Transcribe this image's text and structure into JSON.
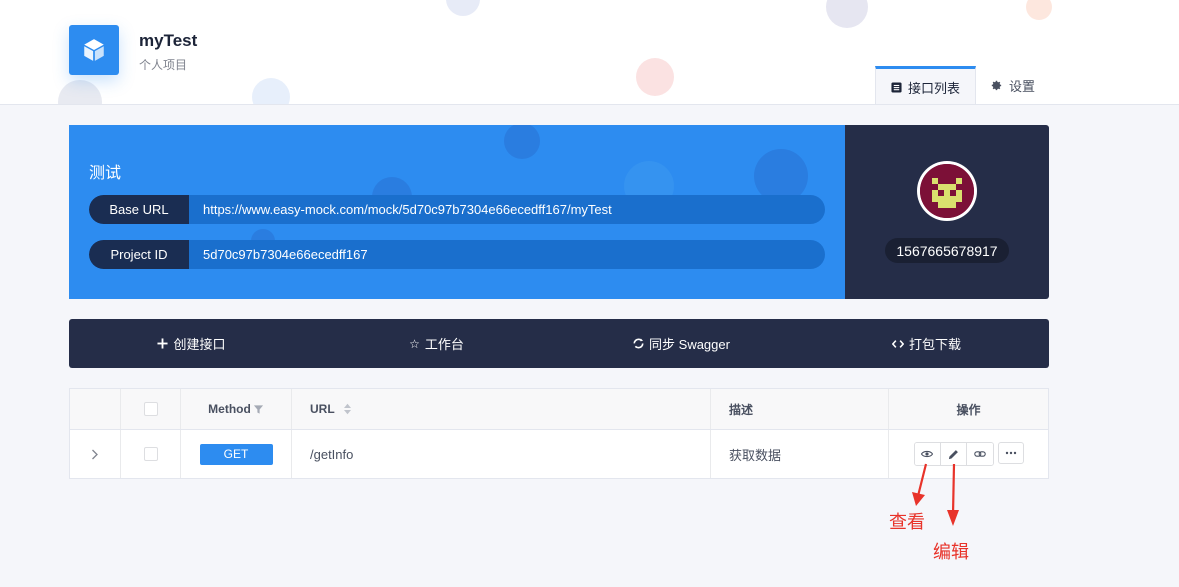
{
  "header": {
    "project_name": "myTest",
    "project_sub": "个人项目",
    "tabs": [
      {
        "label": "接口列表",
        "icon": "list-icon",
        "active": true
      },
      {
        "label": "设置",
        "icon": "gear-icon",
        "active": false
      }
    ]
  },
  "info": {
    "title": "测试",
    "base_url_label": "Base URL",
    "base_url": "https://www.easy-mock.com/mock/5d70c97b7304e66ecedff167/myTest",
    "project_id_label": "Project ID",
    "project_id": "5d70c97b7304e66ecedff167"
  },
  "user": {
    "id": "1567665678917"
  },
  "toolbar": {
    "create": "创建接口",
    "workbench": "工作台",
    "sync": "同步 Swagger",
    "download": "打包下载"
  },
  "table": {
    "headers": {
      "method": "Method",
      "url": "URL",
      "desc": "描述",
      "ops": "操作"
    },
    "rows": [
      {
        "method": "GET",
        "url": "/getInfo",
        "desc": "获取数据"
      }
    ]
  },
  "annotations": {
    "view": "查看",
    "edit": "编辑"
  },
  "colors": {
    "accent": "#2d8cf0",
    "dark": "#252d48",
    "annotation": "#e8332a"
  }
}
